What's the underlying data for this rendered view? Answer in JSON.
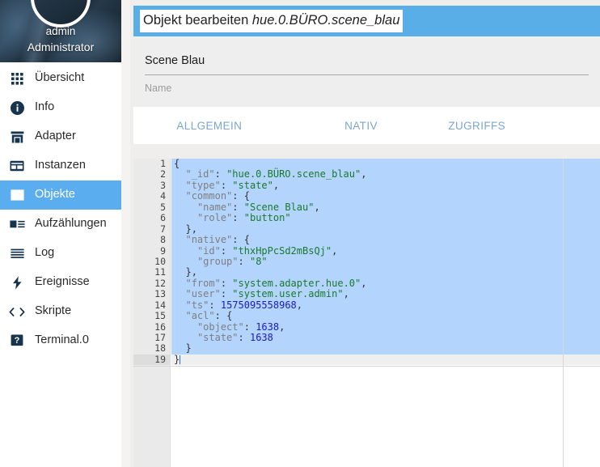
{
  "sidebar": {
    "user": {
      "name": "admin",
      "role": "Administrator"
    },
    "items": [
      {
        "label": "Übersicht",
        "icon": "grid-icon",
        "name": "sidebar-item-uebersicht",
        "active": false
      },
      {
        "label": "Info",
        "icon": "info-icon",
        "name": "sidebar-item-info",
        "active": false
      },
      {
        "label": "Adapter",
        "icon": "store-icon",
        "name": "sidebar-item-adapter",
        "active": false
      },
      {
        "label": "Instanzen",
        "icon": "instances-icon",
        "name": "sidebar-item-instanzen",
        "active": false
      },
      {
        "label": "Objekte",
        "icon": "objects-icon",
        "name": "sidebar-item-objekte",
        "active": true
      },
      {
        "label": "Aufzählungen",
        "icon": "enums-icon",
        "name": "sidebar-item-aufzaehlungen",
        "active": false
      },
      {
        "label": "Log",
        "icon": "list-icon",
        "name": "sidebar-item-log",
        "active": false
      },
      {
        "label": "Ereignisse",
        "icon": "bolt-icon",
        "name": "sidebar-item-ereignisse",
        "active": false
      },
      {
        "label": "Skripte",
        "icon": "code-icon",
        "name": "sidebar-item-skripte",
        "active": false
      },
      {
        "label": "Terminal.0",
        "icon": "question-icon",
        "name": "sidebar-item-terminal",
        "active": false
      }
    ]
  },
  "dialog": {
    "title_prefix": "Objekt bearbeiten ",
    "title_object": "hue.0.BÜRO.scene_blau",
    "name_field": {
      "value": "Scene Blau",
      "label": "Name",
      "placeholder": "Name"
    },
    "tabs": [
      {
        "label": "ALLGEMEIN",
        "name": "tab-allgemein",
        "active": true
      },
      {
        "label": "NATIV",
        "name": "tab-nativ",
        "active": false
      },
      {
        "label": "ZUGRIFFS",
        "name": "tab-zugriffs",
        "active": false
      }
    ]
  },
  "editor": {
    "current_line": 19,
    "selected_lines": [
      1,
      18
    ],
    "fold_lines": [
      1,
      4,
      8,
      15
    ],
    "lines": [
      {
        "n": 1,
        "text": "{"
      },
      {
        "n": 2,
        "text": "  \"_id\": \"hue.0.BÜRO.scene_blau\","
      },
      {
        "n": 3,
        "text": "  \"type\": \"state\","
      },
      {
        "n": 4,
        "text": "  \"common\": {"
      },
      {
        "n": 5,
        "text": "    \"name\": \"Scene Blau\","
      },
      {
        "n": 6,
        "text": "    \"role\": \"button\""
      },
      {
        "n": 7,
        "text": "  },"
      },
      {
        "n": 8,
        "text": "  \"native\": {"
      },
      {
        "n": 9,
        "text": "    \"id\": \"thxHpPcSd2mBsQj\","
      },
      {
        "n": 10,
        "text": "    \"group\": \"8\""
      },
      {
        "n": 11,
        "text": "  },"
      },
      {
        "n": 12,
        "text": "  \"from\": \"system.adapter.hue.0\","
      },
      {
        "n": 13,
        "text": "  \"user\": \"system.user.admin\","
      },
      {
        "n": 14,
        "text": "  \"ts\": 1575095558968,"
      },
      {
        "n": 15,
        "text": "  \"acl\": {"
      },
      {
        "n": 16,
        "text": "    \"object\": 1638,"
      },
      {
        "n": 17,
        "text": "    \"state\": 1638"
      },
      {
        "n": 18,
        "text": "  }"
      },
      {
        "n": 19,
        "text": "}"
      }
    ]
  },
  "colors": {
    "accent_blue": "#5aaee8",
    "sidebar_active": "#5aaef0",
    "selection": "#b3d4fc",
    "string": "#1a7a2e",
    "number": "#1b1bc2",
    "key": "#7f7f7f",
    "tab_text": "#7ba7cc"
  }
}
